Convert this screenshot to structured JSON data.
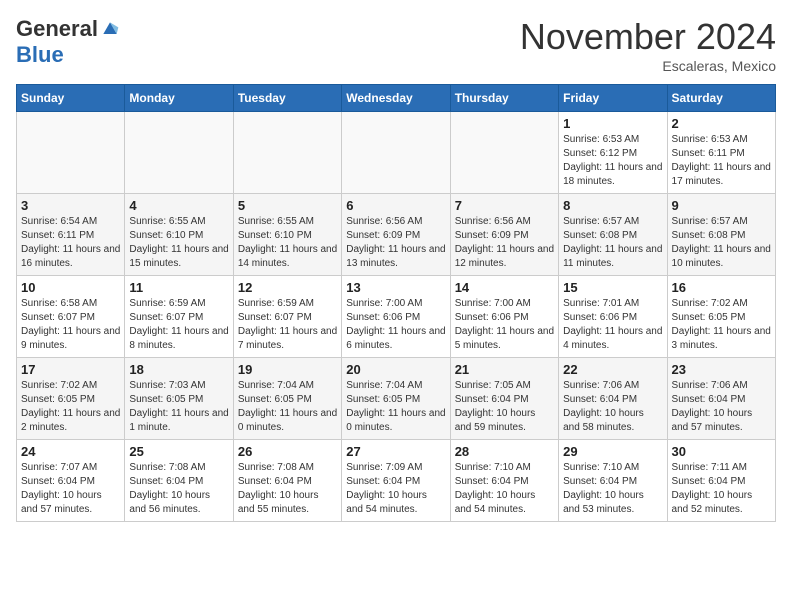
{
  "header": {
    "logo_general": "General",
    "logo_blue": "Blue",
    "month": "November 2024",
    "location": "Escaleras, Mexico"
  },
  "days_of_week": [
    "Sunday",
    "Monday",
    "Tuesday",
    "Wednesday",
    "Thursday",
    "Friday",
    "Saturday"
  ],
  "weeks": [
    [
      {
        "day": "",
        "info": ""
      },
      {
        "day": "",
        "info": ""
      },
      {
        "day": "",
        "info": ""
      },
      {
        "day": "",
        "info": ""
      },
      {
        "day": "",
        "info": ""
      },
      {
        "day": "1",
        "info": "Sunrise: 6:53 AM\nSunset: 6:12 PM\nDaylight: 11 hours and 18 minutes."
      },
      {
        "day": "2",
        "info": "Sunrise: 6:53 AM\nSunset: 6:11 PM\nDaylight: 11 hours and 17 minutes."
      }
    ],
    [
      {
        "day": "3",
        "info": "Sunrise: 6:54 AM\nSunset: 6:11 PM\nDaylight: 11 hours and 16 minutes."
      },
      {
        "day": "4",
        "info": "Sunrise: 6:55 AM\nSunset: 6:10 PM\nDaylight: 11 hours and 15 minutes."
      },
      {
        "day": "5",
        "info": "Sunrise: 6:55 AM\nSunset: 6:10 PM\nDaylight: 11 hours and 14 minutes."
      },
      {
        "day": "6",
        "info": "Sunrise: 6:56 AM\nSunset: 6:09 PM\nDaylight: 11 hours and 13 minutes."
      },
      {
        "day": "7",
        "info": "Sunrise: 6:56 AM\nSunset: 6:09 PM\nDaylight: 11 hours and 12 minutes."
      },
      {
        "day": "8",
        "info": "Sunrise: 6:57 AM\nSunset: 6:08 PM\nDaylight: 11 hours and 11 minutes."
      },
      {
        "day": "9",
        "info": "Sunrise: 6:57 AM\nSunset: 6:08 PM\nDaylight: 11 hours and 10 minutes."
      }
    ],
    [
      {
        "day": "10",
        "info": "Sunrise: 6:58 AM\nSunset: 6:07 PM\nDaylight: 11 hours and 9 minutes."
      },
      {
        "day": "11",
        "info": "Sunrise: 6:59 AM\nSunset: 6:07 PM\nDaylight: 11 hours and 8 minutes."
      },
      {
        "day": "12",
        "info": "Sunrise: 6:59 AM\nSunset: 6:07 PM\nDaylight: 11 hours and 7 minutes."
      },
      {
        "day": "13",
        "info": "Sunrise: 7:00 AM\nSunset: 6:06 PM\nDaylight: 11 hours and 6 minutes."
      },
      {
        "day": "14",
        "info": "Sunrise: 7:00 AM\nSunset: 6:06 PM\nDaylight: 11 hours and 5 minutes."
      },
      {
        "day": "15",
        "info": "Sunrise: 7:01 AM\nSunset: 6:06 PM\nDaylight: 11 hours and 4 minutes."
      },
      {
        "day": "16",
        "info": "Sunrise: 7:02 AM\nSunset: 6:05 PM\nDaylight: 11 hours and 3 minutes."
      }
    ],
    [
      {
        "day": "17",
        "info": "Sunrise: 7:02 AM\nSunset: 6:05 PM\nDaylight: 11 hours and 2 minutes."
      },
      {
        "day": "18",
        "info": "Sunrise: 7:03 AM\nSunset: 6:05 PM\nDaylight: 11 hours and 1 minute."
      },
      {
        "day": "19",
        "info": "Sunrise: 7:04 AM\nSunset: 6:05 PM\nDaylight: 11 hours and 0 minutes."
      },
      {
        "day": "20",
        "info": "Sunrise: 7:04 AM\nSunset: 6:05 PM\nDaylight: 11 hours and 0 minutes."
      },
      {
        "day": "21",
        "info": "Sunrise: 7:05 AM\nSunset: 6:04 PM\nDaylight: 10 hours and 59 minutes."
      },
      {
        "day": "22",
        "info": "Sunrise: 7:06 AM\nSunset: 6:04 PM\nDaylight: 10 hours and 58 minutes."
      },
      {
        "day": "23",
        "info": "Sunrise: 7:06 AM\nSunset: 6:04 PM\nDaylight: 10 hours and 57 minutes."
      }
    ],
    [
      {
        "day": "24",
        "info": "Sunrise: 7:07 AM\nSunset: 6:04 PM\nDaylight: 10 hours and 57 minutes."
      },
      {
        "day": "25",
        "info": "Sunrise: 7:08 AM\nSunset: 6:04 PM\nDaylight: 10 hours and 56 minutes."
      },
      {
        "day": "26",
        "info": "Sunrise: 7:08 AM\nSunset: 6:04 PM\nDaylight: 10 hours and 55 minutes."
      },
      {
        "day": "27",
        "info": "Sunrise: 7:09 AM\nSunset: 6:04 PM\nDaylight: 10 hours and 54 minutes."
      },
      {
        "day": "28",
        "info": "Sunrise: 7:10 AM\nSunset: 6:04 PM\nDaylight: 10 hours and 54 minutes."
      },
      {
        "day": "29",
        "info": "Sunrise: 7:10 AM\nSunset: 6:04 PM\nDaylight: 10 hours and 53 minutes."
      },
      {
        "day": "30",
        "info": "Sunrise: 7:11 AM\nSunset: 6:04 PM\nDaylight: 10 hours and 52 minutes."
      }
    ]
  ]
}
